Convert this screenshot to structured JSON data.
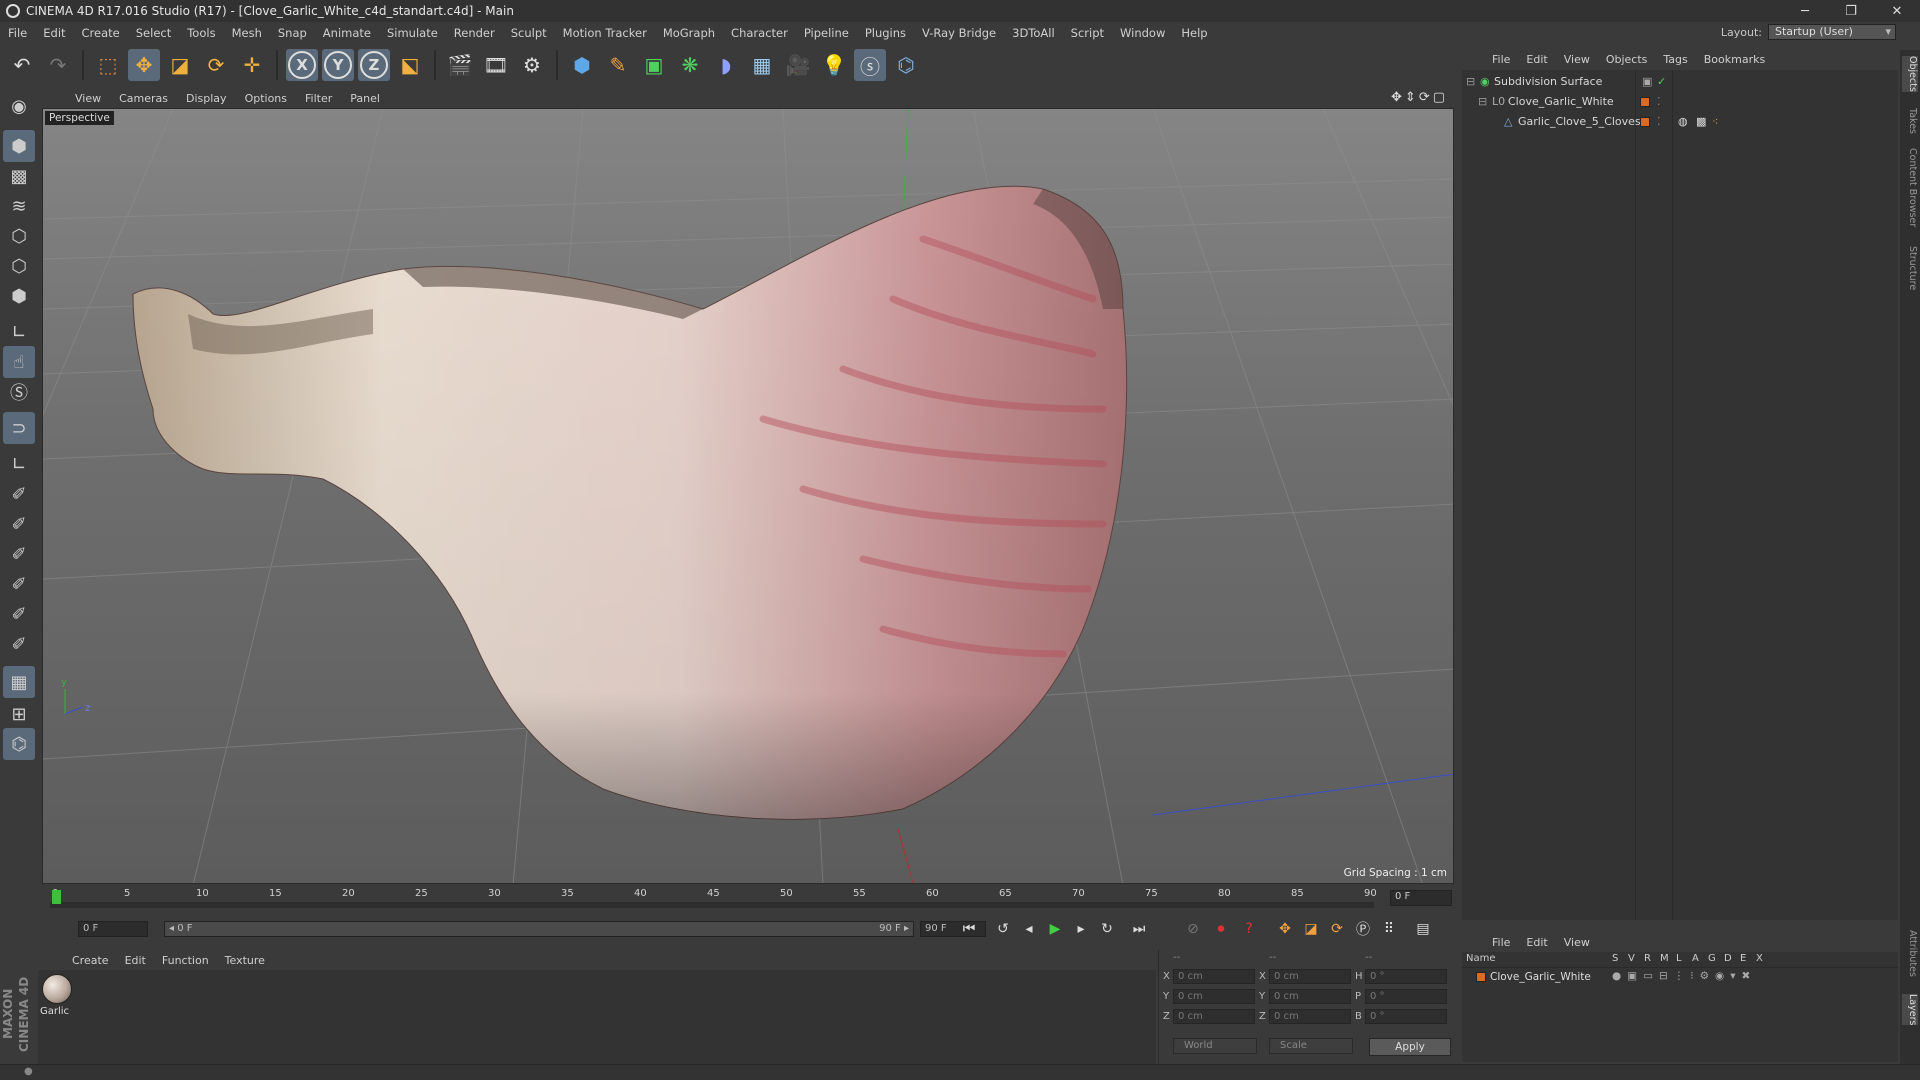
{
  "window": {
    "title": "CINEMA 4D R17.016 Studio (R17) - [Clove_Garlic_White_c4d_standart.c4d] - Main",
    "minimize": "─",
    "restore": "❐",
    "close": "✕"
  },
  "menubar": {
    "items": [
      "File",
      "Edit",
      "Create",
      "Select",
      "Tools",
      "Mesh",
      "Snap",
      "Animate",
      "Simulate",
      "Render",
      "Sculpt",
      "Motion Tracker",
      "MoGraph",
      "Character",
      "Pipeline",
      "Plugins",
      "V-Ray Bridge",
      "3DToAll",
      "Script",
      "Window",
      "Help"
    ],
    "layout_label": "Layout:",
    "layout_value": "Startup (User)"
  },
  "toolbar": {
    "axis_x": "X",
    "axis_y": "Y",
    "axis_z": "Z"
  },
  "viewport": {
    "menu": [
      "View",
      "Cameras",
      "Display",
      "Options",
      "Filter",
      "Panel"
    ],
    "label": "Perspective",
    "grid_spacing": "Grid Spacing : 1 cm",
    "axis_y": "y",
    "axis_z": "z"
  },
  "timeline": {
    "ticks": [
      "0",
      "5",
      "10",
      "15",
      "20",
      "25",
      "30",
      "35",
      "40",
      "45",
      "50",
      "55",
      "60",
      "65",
      "70",
      "75",
      "80",
      "85",
      "90"
    ],
    "current_frame": "0 F",
    "start_field": "0 F",
    "range_start": "◂ 0 F",
    "range_end": "90 F ▸",
    "end_field": "90 F"
  },
  "material_manager": {
    "menu": [
      "Create",
      "Edit",
      "Function",
      "Texture"
    ],
    "material_name": "Garlic"
  },
  "coordinates": {
    "header": [
      "--",
      "--",
      "--"
    ],
    "rows": [
      {
        "axis": "X",
        "pos": "0 cm",
        "size_axis": "X",
        "size": "0 cm",
        "rot_axis": "H",
        "rot": "0 °"
      },
      {
        "axis": "Y",
        "pos": "0 cm",
        "size_axis": "Y",
        "size": "0 cm",
        "rot_axis": "P",
        "rot": "0 °"
      },
      {
        "axis": "Z",
        "pos": "0 cm",
        "size_axis": "Z",
        "size": "0 cm",
        "rot_axis": "B",
        "rot": "0 °"
      }
    ],
    "mode_world": "World",
    "mode_scale": "Scale",
    "apply": "Apply"
  },
  "object_manager": {
    "menu": [
      "File",
      "Edit",
      "View",
      "Objects",
      "Tags",
      "Bookmarks"
    ],
    "objects": [
      {
        "name": "Subdivision Surface",
        "indent": 0
      },
      {
        "name": "Clove_Garlic_White",
        "indent": 1
      },
      {
        "name": "Garlic_Clove_5_Cloves",
        "indent": 2
      }
    ]
  },
  "layer_manager": {
    "menu": [
      "File",
      "Edit",
      "View"
    ],
    "columns": [
      "Name",
      "S",
      "V",
      "R",
      "M",
      "L",
      "A",
      "G",
      "D",
      "E",
      "X"
    ],
    "layer_name": "Clove_Garlic_White"
  },
  "side_tabs": [
    "Objects",
    "Takes",
    "Content Browser",
    "Structure",
    "Attributes",
    "Layers"
  ],
  "maxon_logo": "MAXON CINEMA 4D",
  "colors": {
    "accent": "#5b6a7a",
    "layer_orange": "#d76b2a",
    "playhead_green": "#3fbf3f"
  }
}
